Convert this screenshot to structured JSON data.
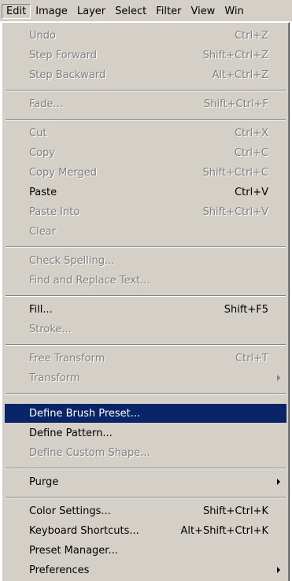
{
  "menubar": {
    "items": [
      "Edit",
      "Image",
      "Layer",
      "Select",
      "Filter",
      "View",
      "Win"
    ]
  },
  "edit_menu": {
    "undo": {
      "label": "Undo",
      "shortcut": "Ctrl+Z"
    },
    "step_forward": {
      "label": "Step Forward",
      "shortcut": "Shift+Ctrl+Z"
    },
    "step_backward": {
      "label": "Step Backward",
      "shortcut": "Alt+Ctrl+Z"
    },
    "fade": {
      "label": "Fade...",
      "shortcut": "Shift+Ctrl+F"
    },
    "cut": {
      "label": "Cut",
      "shortcut": "Ctrl+X"
    },
    "copy": {
      "label": "Copy",
      "shortcut": "Ctrl+C"
    },
    "copy_merged": {
      "label": "Copy Merged",
      "shortcut": "Shift+Ctrl+C"
    },
    "paste": {
      "label": "Paste",
      "shortcut": "Ctrl+V"
    },
    "paste_into": {
      "label": "Paste Into",
      "shortcut": "Shift+Ctrl+V"
    },
    "clear": {
      "label": "Clear"
    },
    "check_spelling": {
      "label": "Check Spelling..."
    },
    "find_replace": {
      "label": "Find and Replace Text..."
    },
    "fill": {
      "label": "Fill...",
      "shortcut": "Shift+F5"
    },
    "stroke": {
      "label": "Stroke..."
    },
    "free_transform": {
      "label": "Free Transform",
      "shortcut": "Ctrl+T"
    },
    "transform": {
      "label": "Transform"
    },
    "define_brush": {
      "label": "Define Brush Preset..."
    },
    "define_pattern": {
      "label": "Define Pattern..."
    },
    "define_custom_shape": {
      "label": "Define Custom Shape..."
    },
    "purge": {
      "label": "Purge"
    },
    "color_settings": {
      "label": "Color Settings...",
      "shortcut": "Shift+Ctrl+K"
    },
    "keyboard_shortcuts": {
      "label": "Keyboard Shortcuts...",
      "shortcut": "Alt+Shift+Ctrl+K"
    },
    "preset_manager": {
      "label": "Preset Manager..."
    },
    "preferences": {
      "label": "Preferences"
    }
  },
  "colors": {
    "menu_bg": "#d4d0c8",
    "highlight": "#0a246a",
    "disabled_text": "#808080"
  }
}
